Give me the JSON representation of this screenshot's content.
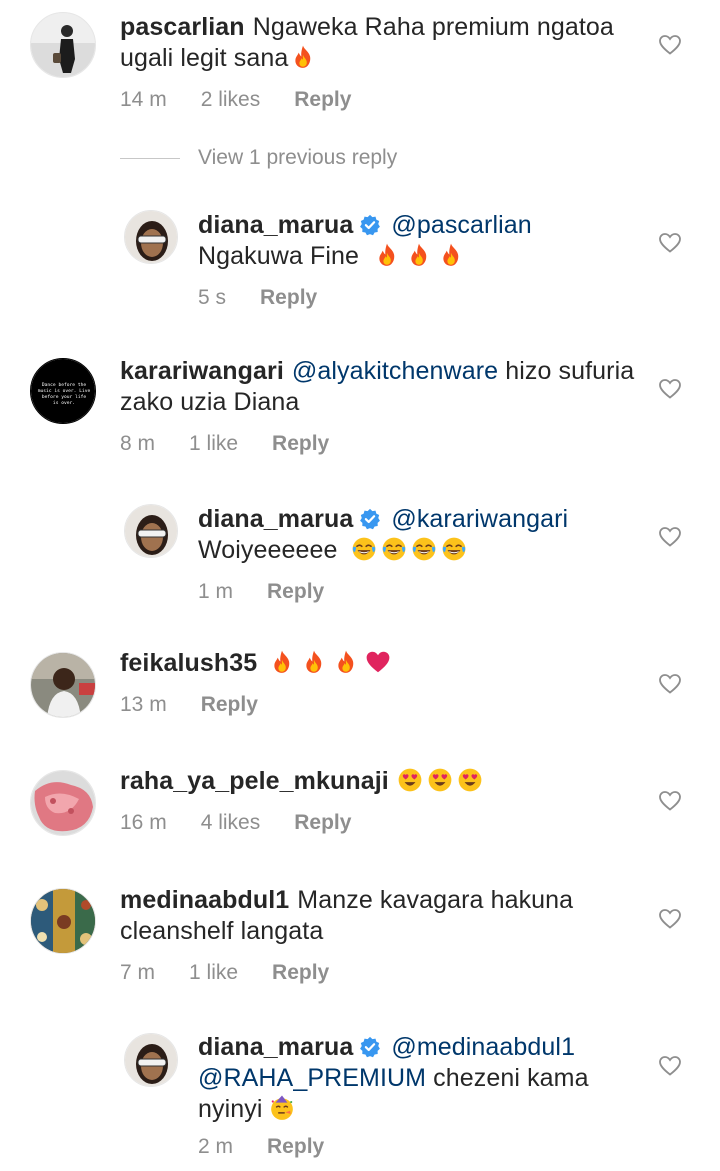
{
  "meta": {
    "reply_label": "Reply"
  },
  "view_replies": {
    "label": "View 1 previous reply"
  },
  "comments": [
    {
      "username": "pascarlian",
      "text": "Ngaweka Raha premium ngatoa ugali legit sana",
      "emojis": [
        "fire"
      ],
      "time": "14 m",
      "likes": "2 likes",
      "verified": false
    },
    {
      "username": "diana_marua",
      "mention": "@pascarlian",
      "text": "Ngakuwa Fine",
      "emojis": [
        "fire",
        "fire",
        "fire"
      ],
      "time": "5 s",
      "likes": "",
      "verified": true
    },
    {
      "username": "karariwangari",
      "mention": "@alyakitchenware",
      "text": "hizo sufuria zako uzia Diana",
      "emojis": [],
      "time": "8 m",
      "likes": "1 like",
      "verified": false,
      "avatar_text": "Dance before the music is over. Live before your life is over."
    },
    {
      "username": "diana_marua",
      "mention": "@karariwangari",
      "text": "Woiyeeeeee",
      "emojis": [
        "joy",
        "joy",
        "joy",
        "joy"
      ],
      "time": "1 m",
      "likes": "",
      "verified": true
    },
    {
      "username": "feikalush35",
      "text": "",
      "emojis": [
        "fire",
        "fire",
        "fire",
        "heart"
      ],
      "time": "13 m",
      "likes": "",
      "verified": false
    },
    {
      "username": "raha_ya_pele_mkunaji",
      "text": "",
      "emojis": [
        "hearteyes",
        "hearteyes",
        "hearteyes"
      ],
      "time": "16 m",
      "likes": "4 likes",
      "verified": false
    },
    {
      "username": "medinaabdul1",
      "text": "Manze kavagara hakuna cleanshelf langata",
      "emojis": [],
      "time": "7 m",
      "likes": "1 like",
      "verified": false
    },
    {
      "username": "diana_marua",
      "mention": "@medinaabdul1",
      "mention2": "@RAHA_PREMIUM",
      "text": "chezeni kama nyinyi",
      "emojis": [
        "party"
      ],
      "time": "2 m",
      "likes": "",
      "verified": true
    }
  ],
  "colors": {
    "text": "#262626",
    "meta": "#8e8e8e",
    "mention": "#00376b",
    "verified": "#3897f0",
    "heart_red": "#e0245e"
  }
}
